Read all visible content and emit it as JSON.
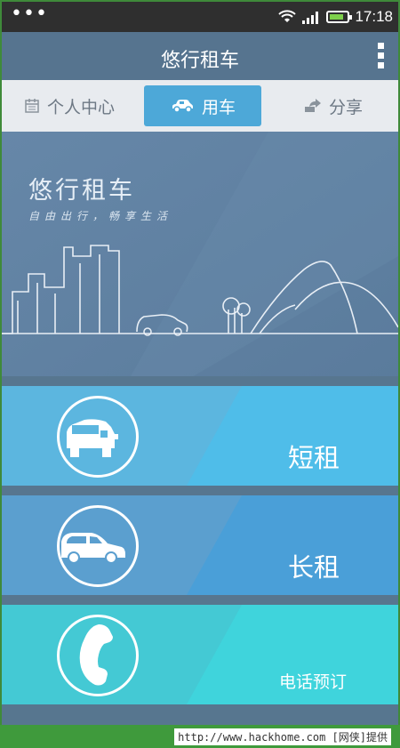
{
  "status_bar": {
    "time": "17:18",
    "icons": [
      "more-dots-icon",
      "wifi-icon",
      "signal-icon",
      "battery-icon"
    ]
  },
  "header": {
    "title": "悠行租车",
    "menu_icon": "overflow-menu-icon"
  },
  "tabs": [
    {
      "label": "个人中心",
      "icon": "calendar-icon",
      "active": false
    },
    {
      "label": "用车",
      "icon": "car-icon",
      "active": true
    },
    {
      "label": "分享",
      "icon": "share-icon",
      "active": false
    }
  ],
  "banner": {
    "title": "悠行租车",
    "subtitle": "自由出行，畅享生活"
  },
  "options": [
    {
      "label": "短租",
      "icon": "car-front-icon",
      "color": "#5cb6df",
      "accent": "#4fbde9"
    },
    {
      "label": "长租",
      "icon": "car-side-icon",
      "color": "#5b9fcf",
      "accent": "#4a9fd8"
    },
    {
      "label": "电话预订",
      "icon": "phone-icon",
      "color": "#44c9d4",
      "accent": "#3fd4dc"
    }
  ],
  "watermark": {
    "text": "http://www.hackhome.com [网侠]提供"
  },
  "colors": {
    "header": "#56748f",
    "tab_active": "#4da8d8",
    "status_bar": "#2f2f2f"
  }
}
